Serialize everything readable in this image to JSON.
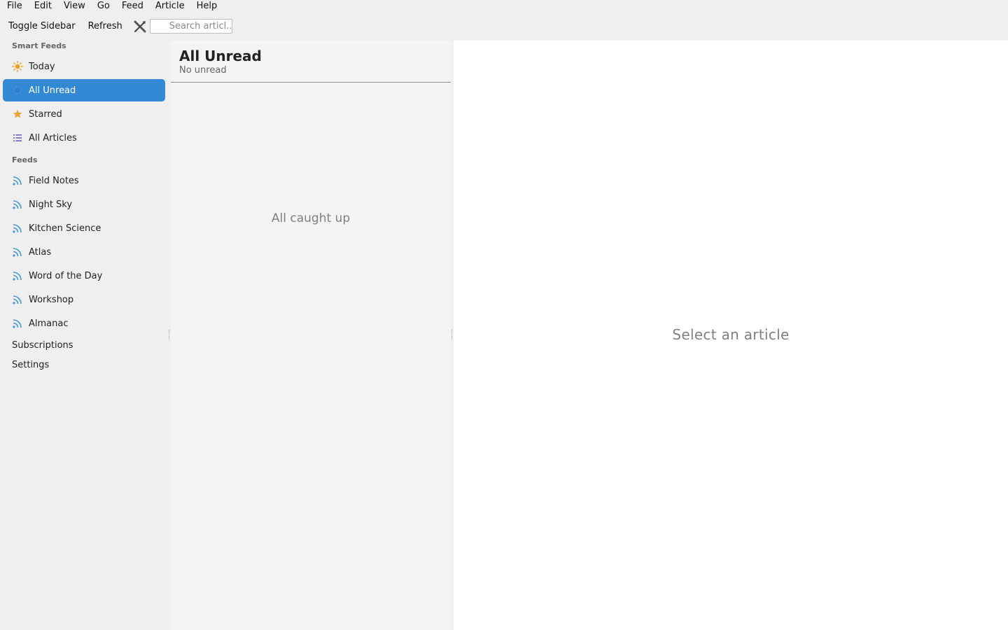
{
  "menubar": {
    "items": [
      "File",
      "Edit",
      "View",
      "Go",
      "Feed",
      "Article",
      "Help"
    ]
  },
  "toolbar": {
    "toggle_sidebar_label": "Toggle Sidebar",
    "refresh_label": "Refresh",
    "tools_icon": "wrench-screwdriver-icon",
    "search_placeholder": "Search articl..."
  },
  "sidebar": {
    "smart_feeds_header": "Smart Feeds",
    "smart_feeds": [
      {
        "label": "Today",
        "icon": "sun-icon"
      },
      {
        "label": "All Unread",
        "icon": "unread-dot-icon",
        "selected": true
      },
      {
        "label": "Starred",
        "icon": "star-icon"
      },
      {
        "label": "All Articles",
        "icon": "list-icon"
      }
    ],
    "feeds_header": "Feeds",
    "feeds": [
      {
        "label": "Field Notes",
        "icon": "rss-icon"
      },
      {
        "label": "Night Sky",
        "icon": "rss-icon"
      },
      {
        "label": "Kitchen Science",
        "icon": "rss-icon"
      },
      {
        "label": "Atlas",
        "icon": "rss-icon"
      },
      {
        "label": "Word of the Day",
        "icon": "rss-icon"
      },
      {
        "label": "Workshop",
        "icon": "rss-icon"
      },
      {
        "label": "Almanac",
        "icon": "rss-icon"
      }
    ],
    "subscriptions_label": "Subscriptions",
    "settings_label": "Settings"
  },
  "article_list": {
    "title": "All Unread",
    "subtitle": "No unread",
    "empty_message": "All caught up"
  },
  "reader": {
    "empty_message": "Select an article"
  },
  "colors": {
    "accent": "#3388d4",
    "sun": "#f0a020",
    "star": "#e8a33a",
    "rss": "#3b9ad9",
    "list_icon": "#6b5fc8"
  }
}
